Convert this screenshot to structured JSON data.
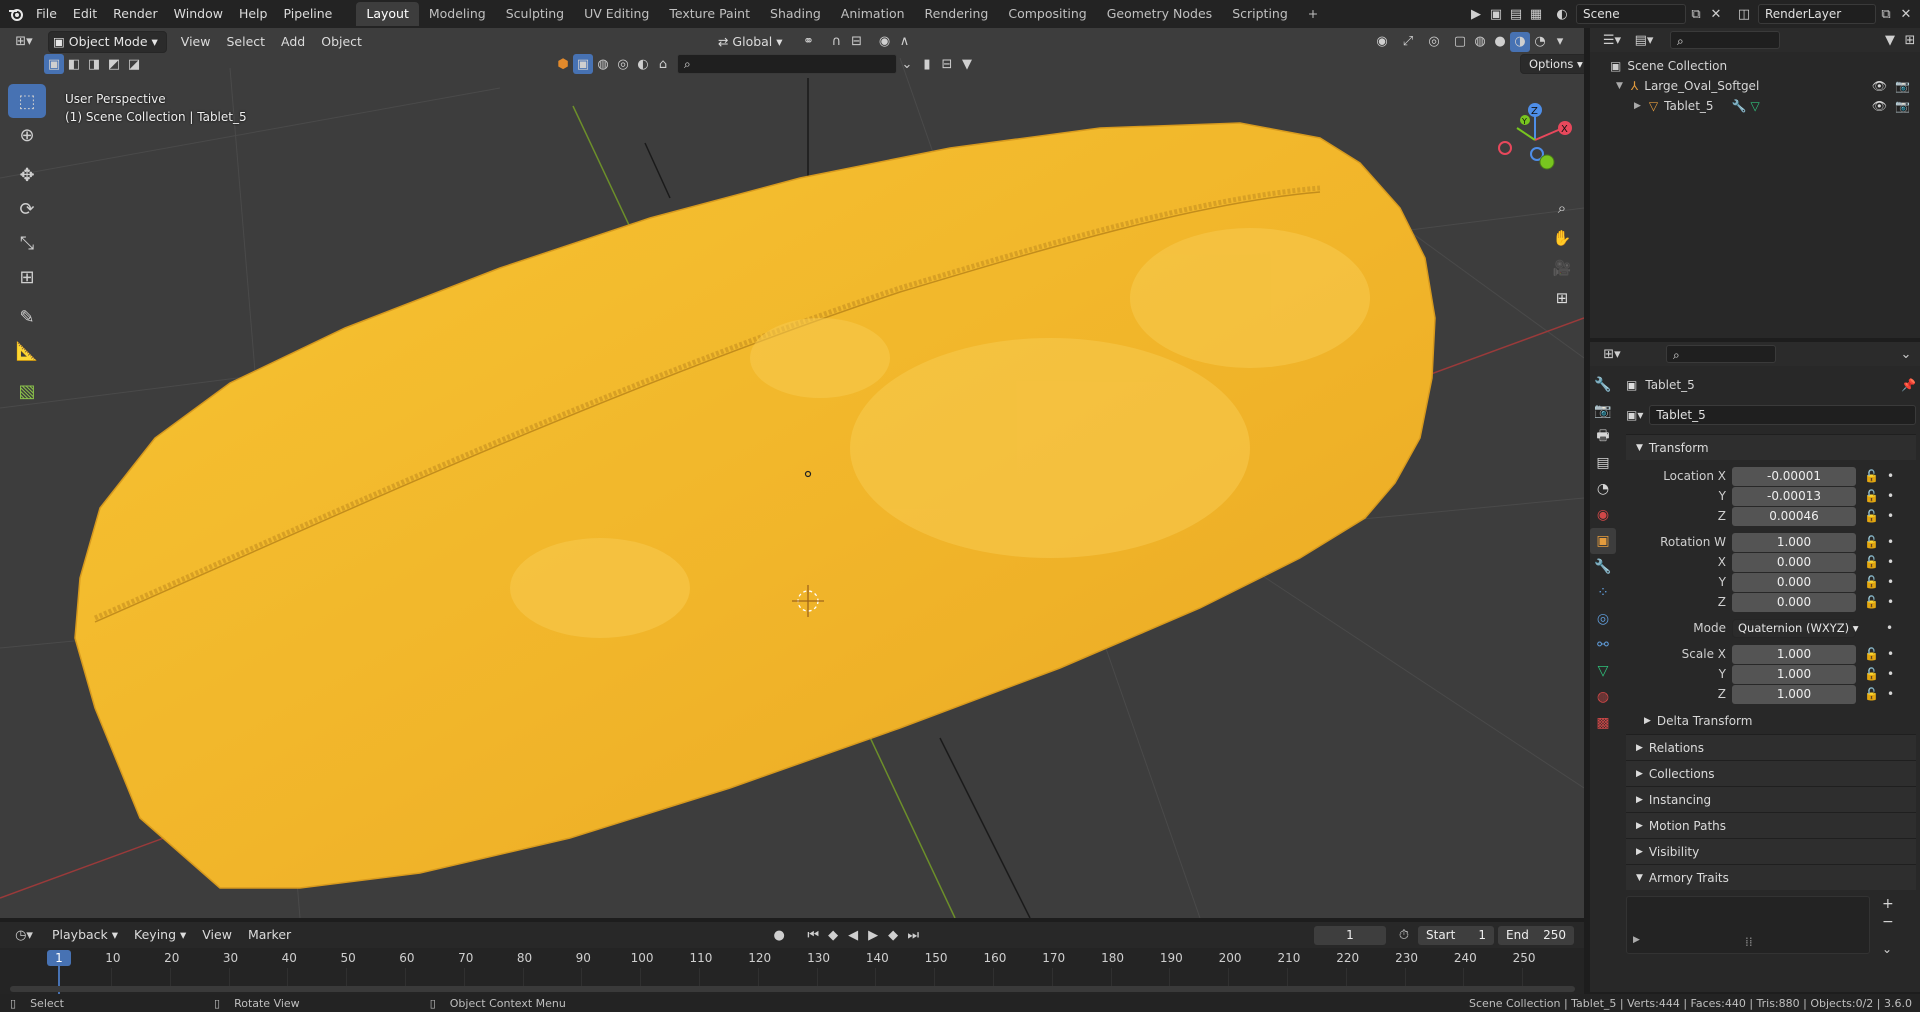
{
  "topbar": {
    "menus": [
      "File",
      "Edit",
      "Render",
      "Window",
      "Help",
      "Pipeline"
    ],
    "workspaces": [
      "Layout",
      "Modeling",
      "Sculpting",
      "UV Editing",
      "Texture Paint",
      "Shading",
      "Animation",
      "Rendering",
      "Compositing",
      "Geometry Nodes",
      "Scripting"
    ],
    "active_workspace": "Layout",
    "add_tab": "+",
    "scene_name": "Scene",
    "render_layer": "RenderLayer"
  },
  "viewport": {
    "mode": "Object Mode",
    "menus": [
      "View",
      "Select",
      "Add",
      "Object"
    ],
    "orientation": "Global",
    "options_label": "Options",
    "perspective": "User Perspective",
    "collection_info": "(1) Scene Collection | Tablet_5",
    "gizmo_axes": {
      "x": "X",
      "y": "Y",
      "z": "Z"
    },
    "object_color": "#f2b72b"
  },
  "outliner": {
    "root": "Scene Collection",
    "items": [
      {
        "name": "Large_Oval_Softgel",
        "level": 1
      },
      {
        "name": "Tablet_5",
        "level": 2
      }
    ]
  },
  "properties": {
    "object_name": "Tablet_5",
    "object_field": "Tablet_5",
    "transform_label": "Transform",
    "location_label": "Location X",
    "location": [
      "-0.00001",
      "-0.00013",
      "0.00046"
    ],
    "rotation_label": "Rotation W",
    "rotation": [
      "1.000",
      "0.000",
      "0.000",
      "0.000"
    ],
    "mode_label": "Mode",
    "mode_value": "Quaternion (WXYZ)",
    "scale_label": "Scale X",
    "scale": [
      "1.000",
      "1.000",
      "1.000"
    ],
    "axis_labels": {
      "x": "X",
      "y": "Y",
      "z": "Z"
    },
    "delta": "Delta Transform",
    "sections": [
      "Relations",
      "Collections",
      "Instancing",
      "Motion Paths",
      "Visibility"
    ],
    "armory": "Armory Traits",
    "add_symbol": "+",
    "remove_symbol": "−"
  },
  "timeline": {
    "menus": [
      "Playback",
      "Keying",
      "View",
      "Marker"
    ],
    "current_frame": "1",
    "start_label": "Start",
    "start": "1",
    "end_label": "End",
    "end": "250",
    "ticks": [
      "1",
      "10",
      "20",
      "30",
      "40",
      "50",
      "60",
      "70",
      "80",
      "90",
      "100",
      "110",
      "120",
      "130",
      "140",
      "150",
      "160",
      "170",
      "180",
      "190",
      "200",
      "210",
      "220",
      "230",
      "240",
      "250"
    ]
  },
  "statusbar": {
    "select": "Select",
    "rotate": "Rotate View",
    "context": "Object Context Menu",
    "stats": "Scene Collection | Tablet_5 | Verts:444 | Faces:440 | Tris:880 | Objects:0/2 | 3.6.0"
  }
}
